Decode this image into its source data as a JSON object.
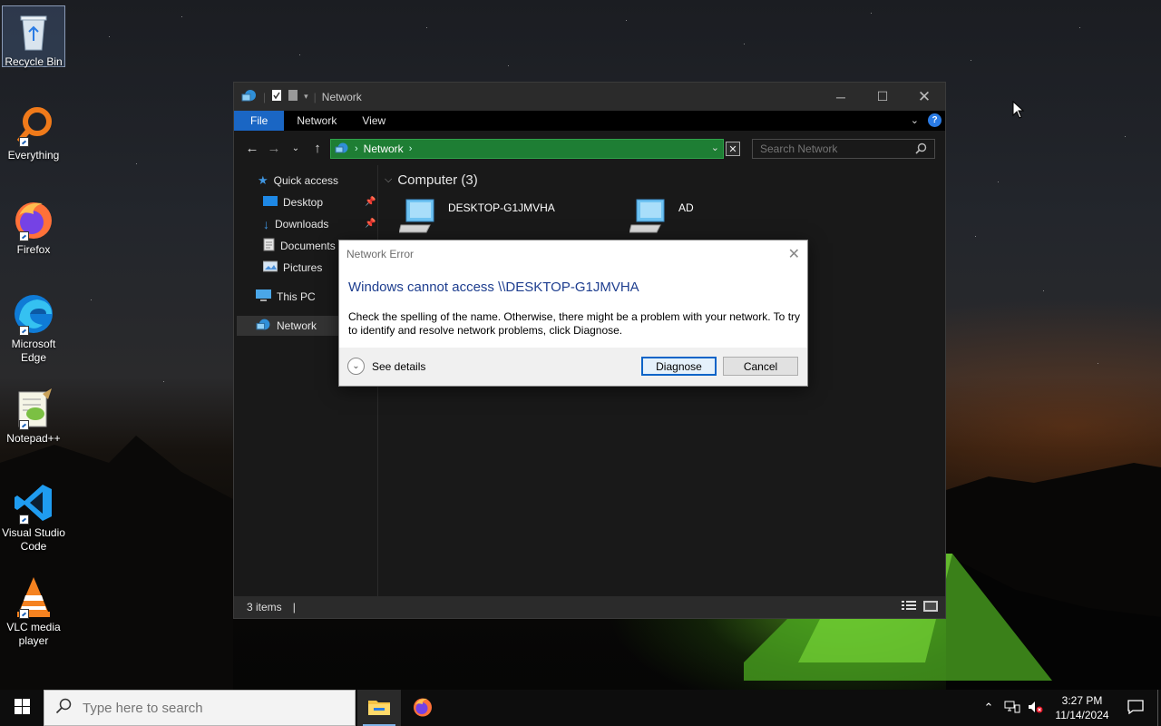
{
  "desktop": {
    "icons": [
      {
        "label": "Recycle Bin",
        "icon": "recycle-bin-icon"
      },
      {
        "label": "Everything",
        "icon": "everything-search-icon"
      },
      {
        "label": "Firefox",
        "icon": "firefox-icon"
      },
      {
        "label": "Microsoft Edge",
        "icon": "edge-icon"
      },
      {
        "label": "Notepad++",
        "icon": "notepadpp-icon"
      },
      {
        "label": "Visual Studio Code",
        "icon": "vscode-icon"
      },
      {
        "label": "VLC media player",
        "icon": "vlc-icon"
      }
    ]
  },
  "explorer": {
    "title": "Network",
    "ribbon_tabs": [
      "File",
      "Network",
      "View"
    ],
    "address": {
      "crumb": "Network"
    },
    "search": {
      "placeholder": "Search Network"
    },
    "nav": {
      "quick_access": "Quick access",
      "items": [
        {
          "label": "Desktop",
          "pinned": true
        },
        {
          "label": "Downloads",
          "pinned": true
        },
        {
          "label": "Documents",
          "pinned": true
        },
        {
          "label": "Pictures",
          "pinned": true
        }
      ],
      "this_pc": "This PC",
      "network": "Network"
    },
    "group": {
      "header": "Computer (3)",
      "items": [
        "DESKTOP-G1JMVHA",
        "AD"
      ]
    },
    "status": {
      "items_count": "3 items"
    }
  },
  "dialog": {
    "title": "Network Error",
    "heading": "Windows cannot access \\\\DESKTOP-G1JMVHA",
    "body": "Check the spelling of the name. Otherwise, there might be a problem with your network. To try to identify and resolve network problems, click Diagnose.",
    "details_label": "See details",
    "diagnose_label": "Diagnose",
    "cancel_label": "Cancel"
  },
  "taskbar": {
    "search_placeholder": "Type here to search",
    "apps": [
      "file-explorer-icon",
      "firefox-icon"
    ],
    "clock": {
      "time": "3:27 PM",
      "date": "11/14/2024"
    }
  },
  "colors": {
    "accent": "#1a66c4",
    "address_bar": "#1e7e34",
    "dialog_heading": "#1e3e8f"
  }
}
